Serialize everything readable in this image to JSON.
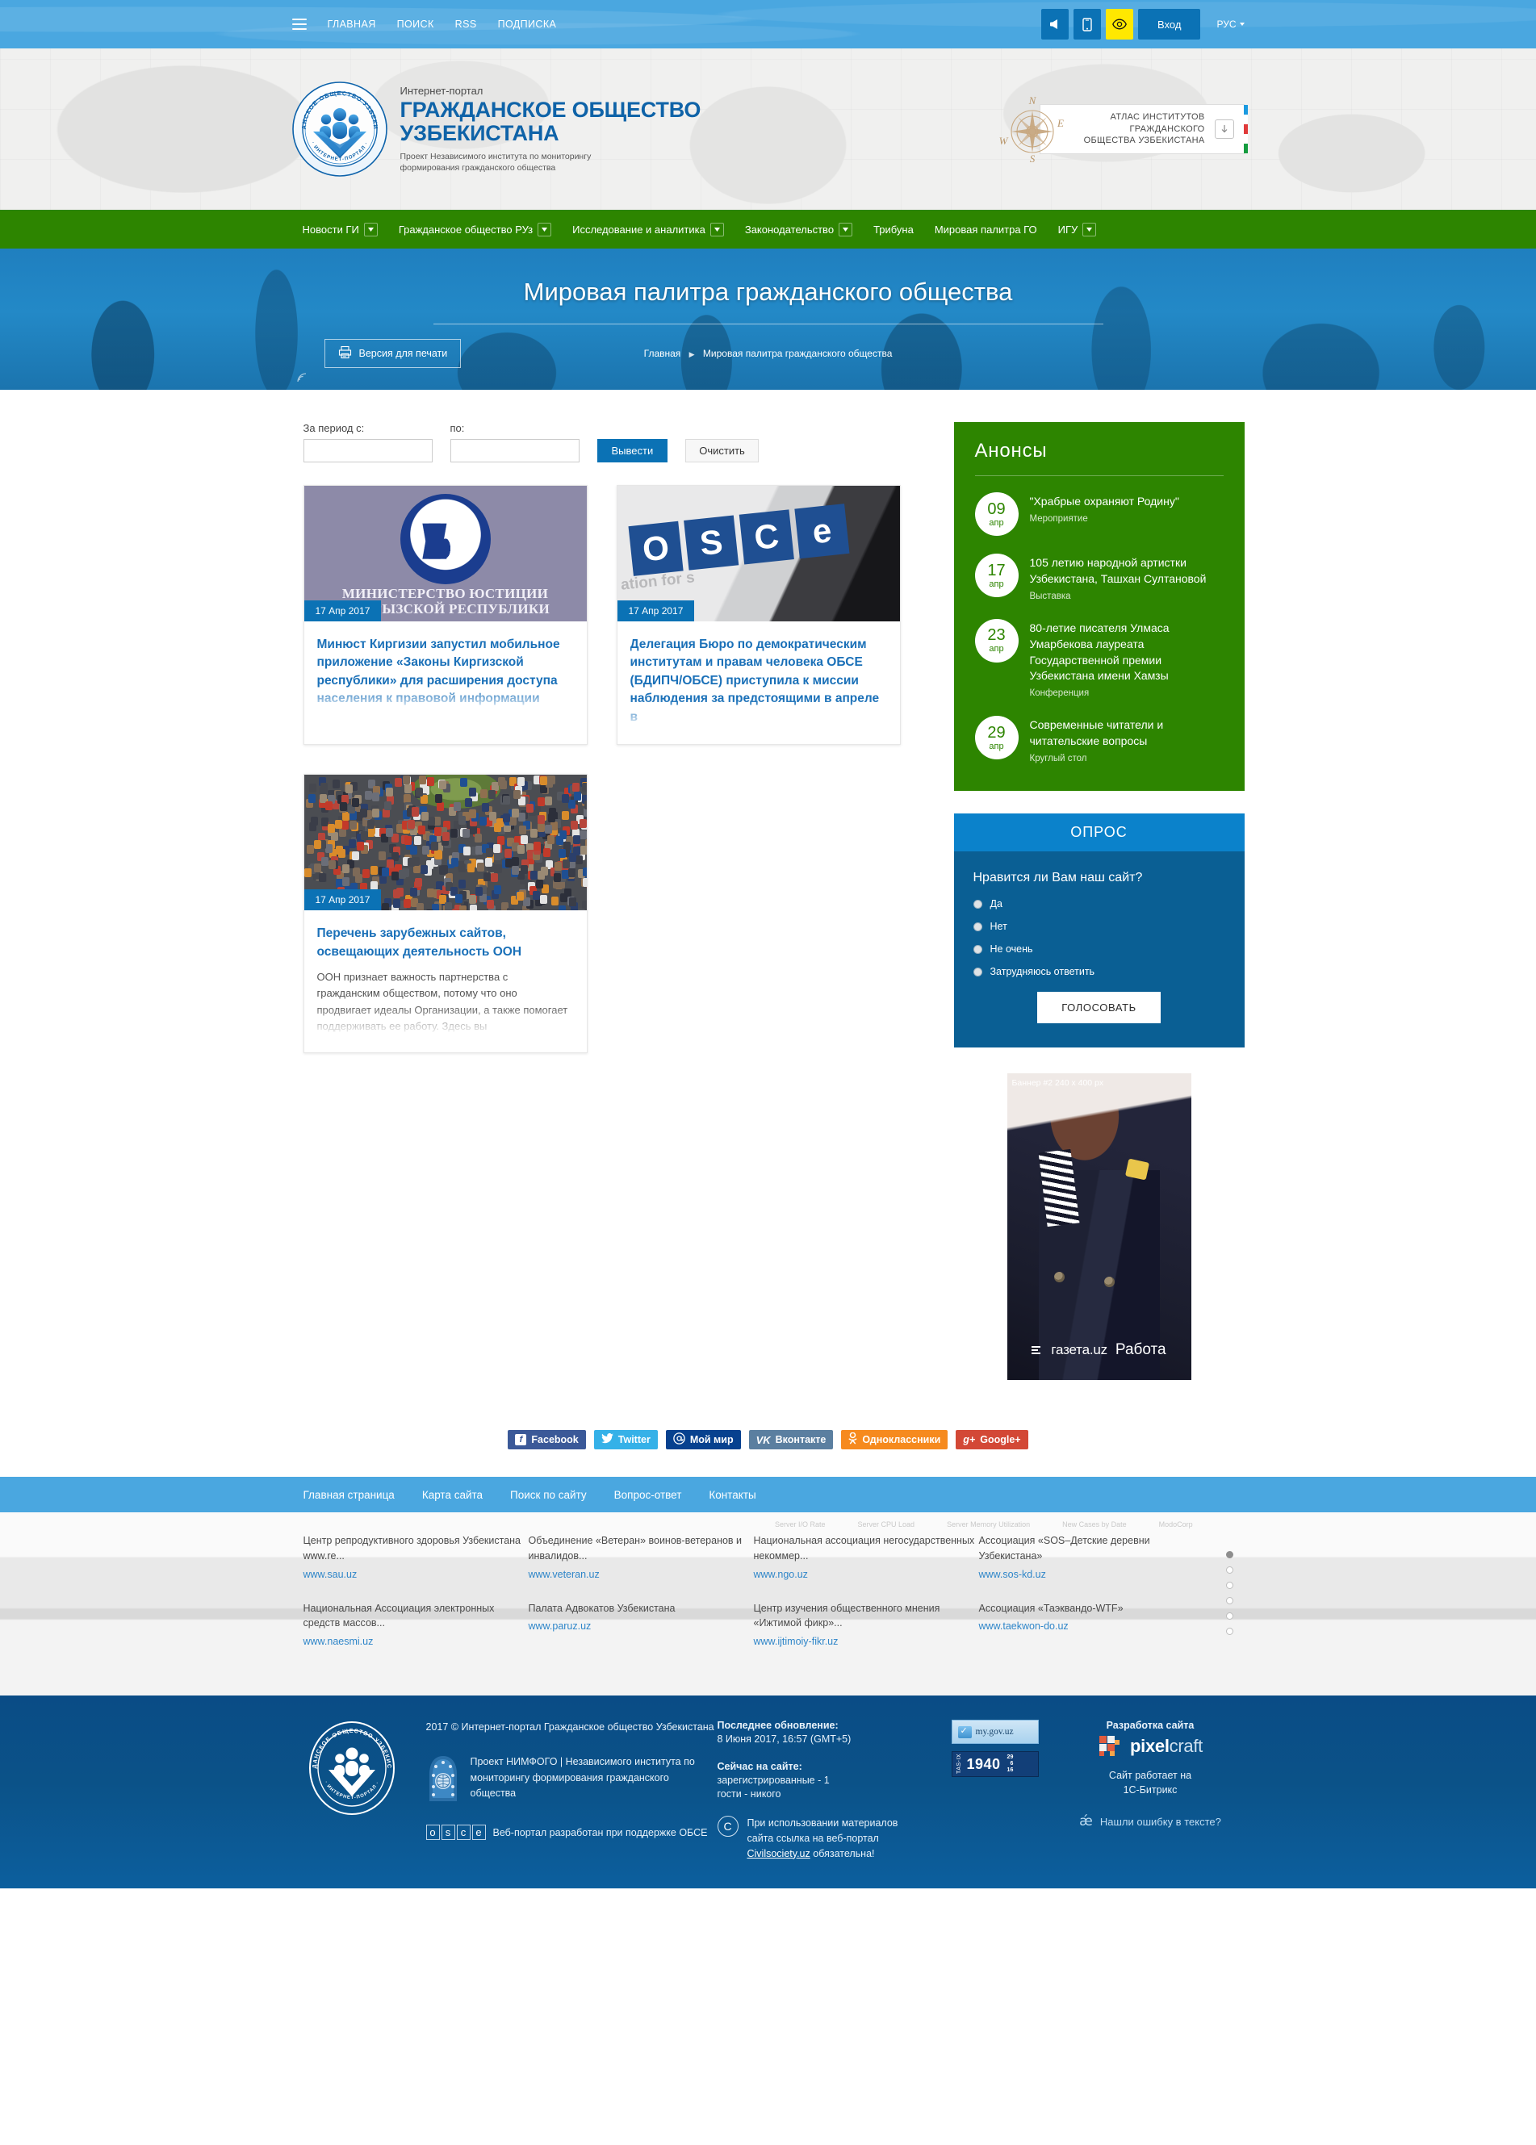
{
  "topbar": {
    "menu_icon": "hamburger-icon",
    "links": [
      "ГЛАВНАЯ",
      "ПОИСК",
      "RSS",
      "ПОДПИСКА"
    ],
    "icons": [
      {
        "name": "megaphone-icon",
        "title": "Объявления"
      },
      {
        "name": "mobile-icon",
        "title": "Мобильная версия"
      },
      {
        "name": "eye-icon",
        "title": "Версия для слабовидящих"
      }
    ],
    "login_label": "Вход",
    "language": "РУС"
  },
  "header": {
    "pre_title": "Интернет-портал",
    "title_line1": "ГРАЖДАНСКОЕ ОБЩЕСТВО",
    "title_line2": "УЗБЕКИСТАНА",
    "subtitle": "Проект Независимого института по мониторингу формирования гражданского общества",
    "seal_text": "ГРАЖДАНСКОЕ ОБЩЕСТВО УЗБЕКИСТАНА · ИНТЕРНЕТ-ПОРТАЛ ·",
    "atlas": {
      "line1": "АТЛАС ИНСТИТУТОВ",
      "line2": "ГРАЖДАНСКОГО",
      "line3": "ОБЩЕСТВА УЗБЕКИСТАНА",
      "download_icon": "download-arrow-icon",
      "compass_labels": [
        "N",
        "E",
        "S",
        "W"
      ],
      "stripe_colors": [
        "#1b9ae0",
        "#ffffff",
        "#e03a3a",
        "#ffffff",
        "#159c3f"
      ]
    }
  },
  "mainnav": {
    "bg": "#2d8500",
    "items": [
      {
        "label": "Новости ГИ",
        "has_dropdown": true
      },
      {
        "label": "Гражданское общество РУз",
        "has_dropdown": true
      },
      {
        "label": "Исследование и аналитика",
        "has_dropdown": true
      },
      {
        "label": "Законодательство",
        "has_dropdown": true
      },
      {
        "label": "Трибуна",
        "has_dropdown": false
      },
      {
        "label": "Мировая палитра ГО",
        "has_dropdown": false
      },
      {
        "label": "ИГУ",
        "has_dropdown": true
      }
    ]
  },
  "hero": {
    "title": "Мировая палитра гражданского общества",
    "print_label": "Версия для печати",
    "print_icon": "printer-icon",
    "breadcrumbs": [
      "Главная",
      "Мировая палитра гражданского общества"
    ]
  },
  "filters": {
    "from_label": "За период с:",
    "from_value": "",
    "to_label": "по:",
    "to_value": "",
    "submit_label": "Вывести",
    "reset_label": "Очистить"
  },
  "news": [
    {
      "date": "17 Апр 2017",
      "title": "Минюст Киргизии запустил мобильное приложение «Законы Киргизской республики» для расширения доступа населения к правовой информации",
      "text": "",
      "image": "kyrgyz-ministry-of-justice-emblem",
      "image_caption_line1": "МИНИСТЕРСТВО ЮСТИЦИИ",
      "image_caption_line2": "КЫРГЫЗСКОЙ РЕСПУБЛИКИ"
    },
    {
      "date": "17 Апр 2017",
      "title": "Делегация Бюро по демократическим институтам и правам человека ОБСЕ (БДИПЧ/ОБСЕ) приступила к миссии наблюдения за предстоящими в апреле в",
      "text": "",
      "image": "osce-sign",
      "image_caption_line1": "OSCE",
      "image_caption_line2": "ation for s"
    },
    {
      "date": "17 Апр 2017",
      "title": "Перечень зарубежных сайтов, освещающих деятельность ООН",
      "text": "ООН признает важность партнерства с гражданским обществом, потому что оно продвигает идеалы Организации, а также помогает поддерживать ее работу. Здесь вы",
      "image": "crowd-photo",
      "image_caption_line1": "",
      "image_caption_line2": ""
    }
  ],
  "announcements": {
    "title": "Анонсы",
    "items": [
      {
        "day": "09",
        "month": "апр",
        "title": "\"Храбрые охраняют Родину\"",
        "type": "Мероприятие"
      },
      {
        "day": "17",
        "month": "апр",
        "title": "105 летию народной артистки Узбекистана, Ташхан Султановой",
        "type": "Выставка"
      },
      {
        "day": "23",
        "month": "апр",
        "title": "80-летие писателя Улмаса Умарбекова лауреата Государственной премии Узбекистана имени Хамзы",
        "type": "Конференция"
      },
      {
        "day": "29",
        "month": "апр",
        "title": "Современные читатели и читательские вопросы",
        "type": "Круглый стол"
      }
    ]
  },
  "poll": {
    "title": "ОПРОС",
    "question": "Нравится ли Вам наш сайт?",
    "options": [
      "Да",
      "Нет",
      "Не очень",
      "Затрудняюсь ответить"
    ],
    "button_label": "ГОЛОСОВАТЬ"
  },
  "banner": {
    "label": "Баннер #2 240 x 400 px",
    "logo_text": "газета.uz",
    "logo_suffix": "Работа"
  },
  "social": [
    {
      "label": "Facebook",
      "glyph": "f",
      "bg": "#3b5998",
      "badge_bg": "#ffffff",
      "badge_fg": "#3b5998"
    },
    {
      "label": "Twitter",
      "glyph": "🐦",
      "bg": "#35b1e8",
      "badge_bg": "#35b1e8",
      "badge_fg": "#ffffff"
    },
    {
      "label": "Мой мир",
      "glyph": "@",
      "bg": "#07418f",
      "badge_bg": "#07418f",
      "badge_fg": "#ffffff"
    },
    {
      "label": "Вконтакте",
      "glyph": "VK",
      "bg": "#5b7fa0",
      "badge_bg": "#5b7fa0",
      "badge_fg": "#ffffff"
    },
    {
      "label": "Одноклассники",
      "glyph": "O",
      "bg": "#f68a1e",
      "badge_bg": "#f68a1e",
      "badge_fg": "#ffffff"
    },
    {
      "label": "Google+",
      "glyph": "g+",
      "bg": "#d34836",
      "badge_bg": "#d34836",
      "badge_fg": "#ffffff"
    }
  ],
  "footnav": [
    "Главная страница",
    "Карта сайта",
    "Поиск по сайту",
    "Вопрос-ответ",
    "Контакты"
  ],
  "partners": [
    {
      "name": "Центр репродуктивного здоровья Узбекистана www.re...",
      "url": "www.sau.uz"
    },
    {
      "name": "Объединение «Ветеран» воинов-ветеранов и инвалидов...",
      "url": "www.veteran.uz"
    },
    {
      "name": "Национальная ассоциация негосударственных некоммер...",
      "url": "www.ngo.uz"
    },
    {
      "name": "Ассоциация «SOS–Детские деревни Узбекистана»",
      "url": "www.sos-kd.uz"
    },
    {
      "name": "Национальная Ассоциация электронных средств массов...",
      "url": "www.naesmi.uz"
    },
    {
      "name": "Палата Адвокатов Узбекистана",
      "url": "www.paruz.uz"
    },
    {
      "name": "Центр изучения общественного мнения «Ижтимой фикр»...",
      "url": "www.ijtimoiy-fikr.uz"
    },
    {
      "name": "Ассоциация «Таэквандо-WTF»",
      "url": "www.taekwon-do.uz"
    }
  ],
  "partners_ghost_headers": [
    "Server I/O Rate",
    "Server CPU Load",
    "Server Memory Utilization",
    "New Cases by Date",
    "ModoCorp"
  ],
  "footer": {
    "copyright": "2017 © Интернет-портал Гражданское общество Узбекистана",
    "nimfogo": "Проект НИМФОГО | Независимого института по мониторингу формирования гражданского общества",
    "osce_text": "Веб-портал разработан при поддержке ОБСЕ",
    "osce_letters": [
      "o",
      "s",
      "c",
      "e"
    ],
    "last_update_label": "Последнее обновление:",
    "last_update_value": "8 Июня 2017, 16:57 (GMT+5)",
    "online_label": "Сейчас на сайте:",
    "online_registered": "зарегистрированные - 1",
    "online_guests": "гости - никого",
    "usage_line1": "При использовании материалов",
    "usage_line2": "сайта ссылка на веб-портал",
    "usage_link": "Civilsociety.uz",
    "usage_line3": " обязательна!",
    "counter_mygov": "my.gov.uz",
    "counter_tasix_label": "TAS-IX",
    "counter_tasix_value": "1940",
    "counter_tasix_stats": [
      "29",
      "6",
      "16"
    ],
    "dev_label": "Разработка сайта",
    "dev_name_bold": "pixel",
    "dev_name_light": "craft",
    "powered_line1": "Сайт работает на",
    "powered_line2": "1С-Битрикс",
    "error_label": "Нашли ошибку в тексте?"
  }
}
